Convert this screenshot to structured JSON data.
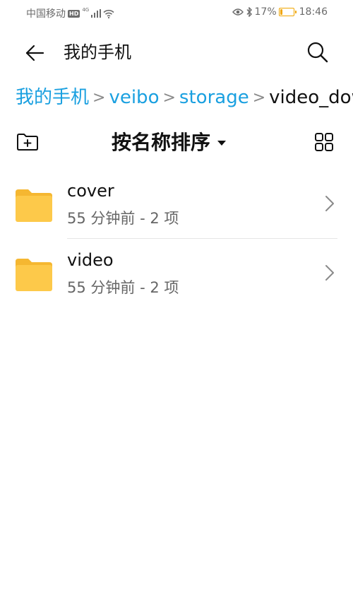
{
  "status_bar": {
    "carrier": "中国移动",
    "hd_badge": "HD",
    "network": "4G",
    "battery_percent": "17%",
    "battery_level": 0.17,
    "time": "18:46",
    "icons": [
      "signal-icon",
      "wifi-icon",
      "eye-icon",
      "bluetooth-icon",
      "battery-icon"
    ],
    "battery_color": "#f0a500"
  },
  "app_bar": {
    "title": "我的手机",
    "back_icon": "back-arrow-icon",
    "search_icon": "search-icon"
  },
  "breadcrumb": {
    "items": [
      "我的手机",
      "veibo",
      "storage",
      "video_dow"
    ],
    "separator": ">",
    "link_color": "#1aa0e0"
  },
  "toolbar": {
    "new_folder_icon": "new-folder-icon",
    "sort_label": "按名称排序",
    "sort_caret_icon": "caret-down-icon",
    "view_toggle_icon": "grid-view-icon"
  },
  "files": [
    {
      "name": "cover",
      "meta": "55 分钟前 - 2 项",
      "icon": "folder-icon"
    },
    {
      "name": "video",
      "meta": "55 分钟前 - 2 项",
      "icon": "folder-icon"
    }
  ],
  "colors": {
    "folder": "#fdc94a",
    "folder_tab": "#f5b731"
  }
}
